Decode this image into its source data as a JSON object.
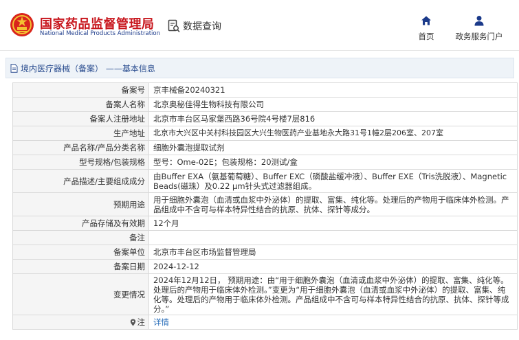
{
  "header": {
    "logo_cn": "国家药品监督管理局",
    "logo_en": "National Medical Products Administration",
    "query_label": "数据查询",
    "nav": [
      {
        "label": "首页",
        "icon": "home-icon"
      },
      {
        "label": "政务服务门户",
        "icon": "user-icon"
      }
    ]
  },
  "breadcrumb": {
    "text": "境内医疗器械（备案） ——基本信息",
    "icon": "document-icon"
  },
  "table": {
    "rows": [
      {
        "label": "备案号",
        "value": "京丰械备20240321"
      },
      {
        "label": "备案人名称",
        "value": "北京奥秘佳得生物科技有限公司"
      },
      {
        "label": "备案人注册地址",
        "value": "北京市丰台区马家堡西路36号院4号楼7层816"
      },
      {
        "label": "生产地址",
        "value": "北京市大兴区中关村科技园区大兴生物医药产业基地永大路31号1幢2层206室、207室"
      },
      {
        "label": "产品名称/产品分类名称",
        "value": "细胞外囊泡提取试剂"
      },
      {
        "label": "型号规格/包装规格",
        "value": "型号：Ome-02E；包装规格：20测试/盒"
      },
      {
        "label": "产品描述/主要组成成分",
        "value": "由Buffer EXA（氨基葡萄糖）、Buffer EXC（磷酸盐缓冲液）、Buffer EXE（Tris洗脱液）、Magnetic Beads(磁珠）及0.22 μm针头式过滤器组成。"
      },
      {
        "label": "预期用途",
        "value": "用于细胞外囊泡（血清或血浆中外泌体）的提取、富集、纯化等。处理后的产物用于临床体外检测。产品组成中不含可与样本特异性结合的抗原、抗体、探针等成分。"
      },
      {
        "label": "产品存储及有效期",
        "value": "12个月"
      },
      {
        "label": "备注",
        "value": ""
      },
      {
        "label": "备案单位",
        "value": "北京市丰台区市场监督管理局"
      },
      {
        "label": "备案日期",
        "value": "2024-12-12"
      },
      {
        "label": "变更情况",
        "value": "2024年12月12日， 预期用途：由“用于细胞外囊泡（血清或血浆中外泌体）的提取、富集、纯化等。处理后的产物用于临床体外检测。”变更为“用于细胞外囊泡（血清或血浆中外泌体）的提取、富集、纯化等。处理后的产物用于临床体外检测。产品组成中不含可与样本特异性结合的抗原、抗体、探针等成分。”"
      }
    ],
    "note_row": {
      "label": "注",
      "value": "详情",
      "icon": "info-pin-icon"
    }
  },
  "colors": {
    "brand_red": "#c8161d",
    "brand_blue": "#1b3a8a",
    "link": "#1e66b5",
    "breadcrumb_bg": "#eef3f8"
  }
}
